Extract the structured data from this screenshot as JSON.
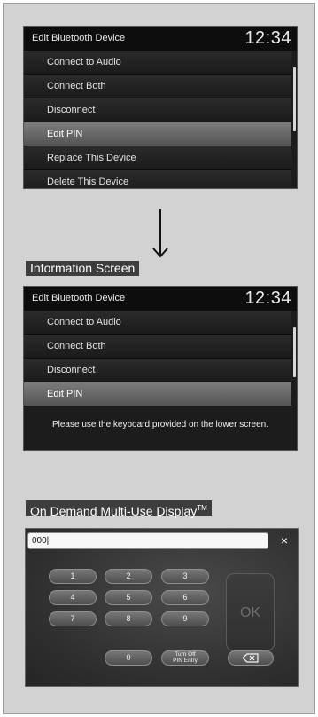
{
  "top_screen": {
    "title": "Edit Bluetooth Device",
    "clock": "12:34",
    "items": [
      {
        "label": "Connect to Audio",
        "selected": false
      },
      {
        "label": "Connect Both",
        "selected": false
      },
      {
        "label": "Disconnect",
        "selected": false
      },
      {
        "label": "Edit PIN",
        "selected": true
      },
      {
        "label": "Replace This Device",
        "selected": false
      },
      {
        "label": "Delete This Device",
        "selected": false
      }
    ]
  },
  "info_caption": "Information Screen",
  "info_screen": {
    "title": "Edit Bluetooth Device",
    "clock": "12:34",
    "items": [
      {
        "label": "Connect to Audio",
        "selected": false
      },
      {
        "label": "Connect Both",
        "selected": false
      },
      {
        "label": "Disconnect",
        "selected": false
      },
      {
        "label": "Edit PIN",
        "selected": true
      }
    ],
    "message": "Please use the keyboard provided on the lower screen."
  },
  "display_caption": {
    "text": "On Demand Multi-Use Display",
    "mark": "TM"
  },
  "keypad": {
    "pin_value": "000|",
    "close_glyph": "×",
    "keys": [
      "1",
      "2",
      "3",
      "4",
      "5",
      "6",
      "7",
      "8",
      "9",
      "0"
    ],
    "turn_off_line1": "Turn Off",
    "turn_off_line2": "PIN Entry",
    "ok_label": "OK",
    "backspace_icon": "backspace-icon"
  },
  "colors": {
    "caption_bg": "#3d3d3d",
    "screen_bg": "#1c1c1c",
    "selected_item": "#6a6a6a",
    "frame_bg": "#d2d2d2"
  }
}
